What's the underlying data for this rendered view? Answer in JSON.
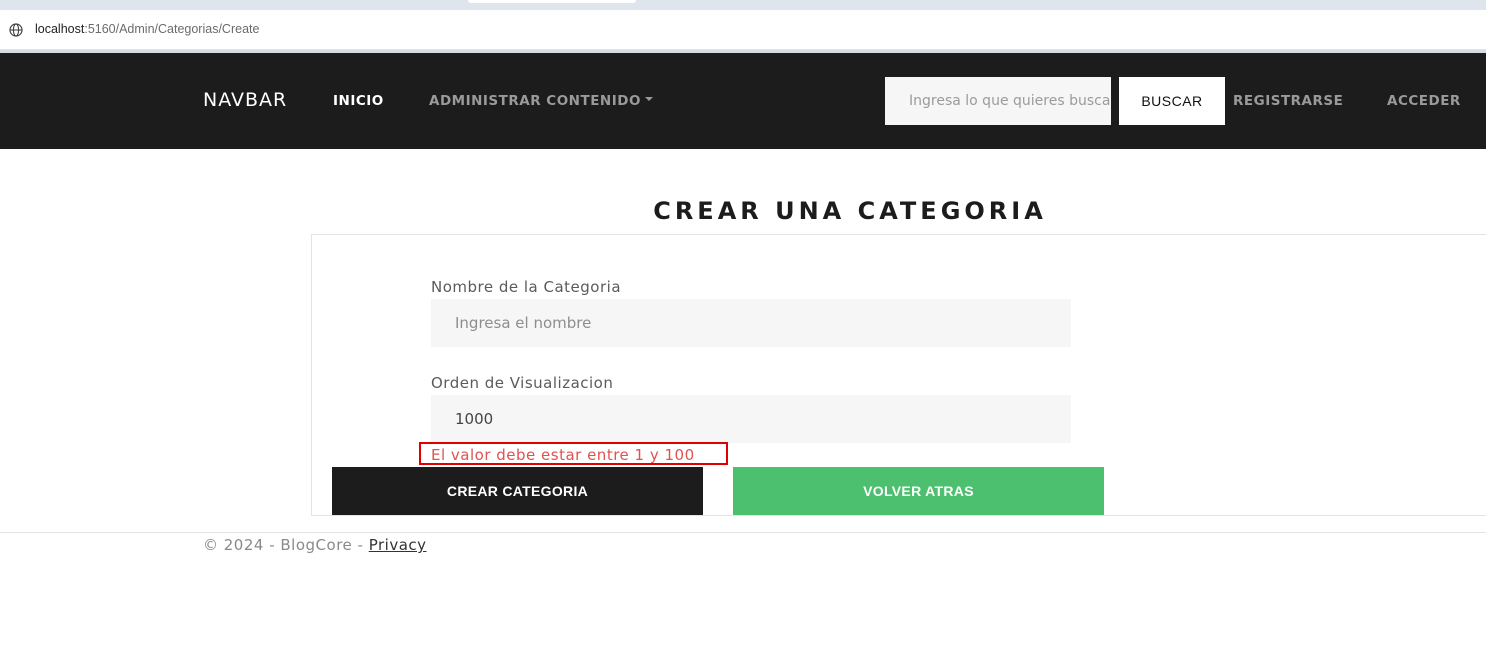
{
  "browser": {
    "url_host": "localhost",
    "url_path": ":5160/Admin/Categorias/Create"
  },
  "navbar": {
    "brand": "NAVBAR",
    "inicio": "INICIO",
    "admin_menu": "ADMINISTRAR CONTENIDO",
    "search_placeholder": "Ingresa lo que quieres buscar",
    "search_button": "BUSCAR",
    "register": "REGISTRARSE",
    "login": "ACCEDER"
  },
  "page": {
    "title": "CREAR UNA CATEGORIA"
  },
  "form": {
    "name_label": "Nombre de la Categoria",
    "name_placeholder": "Ingresa el nombre",
    "order_label": "Orden de Visualizacion",
    "order_value": "1000",
    "order_error": "El valor debe estar entre 1 y 100",
    "submit_label": "CREAR CATEGORIA",
    "back_label": "VOLVER ATRAS"
  },
  "footer": {
    "copyright": "© 2024 - BlogCore - ",
    "privacy_link": "Privacy"
  },
  "colors": {
    "navbar_bg": "#1c1c1c",
    "back_button": "#4cc06f",
    "error": "#e05252",
    "highlight_box": "#e00000"
  }
}
